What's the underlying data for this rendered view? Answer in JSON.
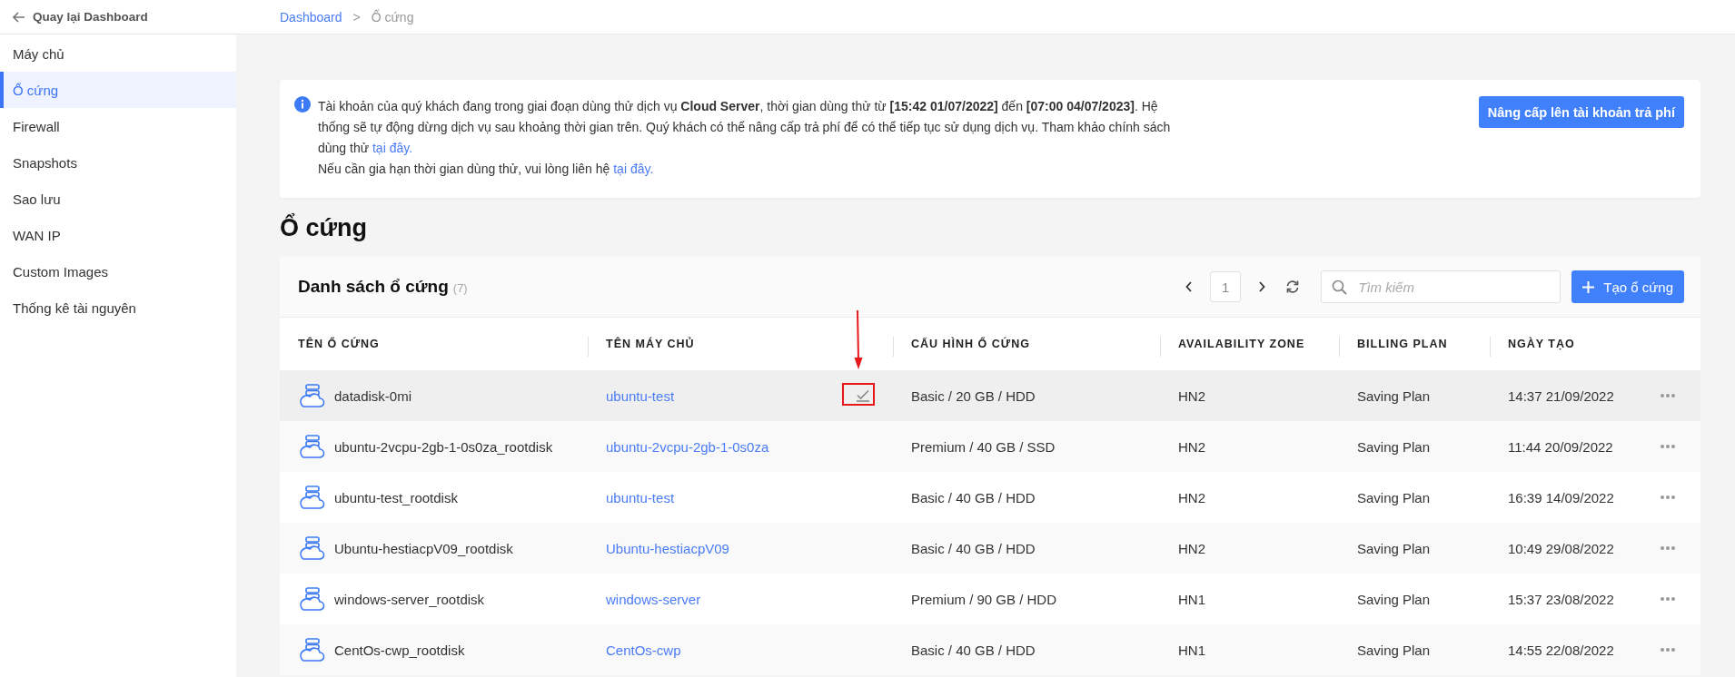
{
  "back_link": "Quay lại Dashboard",
  "breadcrumb": [
    {
      "label": "Dashboard",
      "kind": "link"
    },
    {
      "label": ">",
      "kind": "separator"
    },
    {
      "label": "Ổ cứng",
      "kind": "current"
    }
  ],
  "sidebar": {
    "items": [
      {
        "label": "Máy chủ",
        "selected": false
      },
      {
        "label": "Ổ cứng",
        "selected": true
      },
      {
        "label": "Firewall",
        "selected": false
      },
      {
        "label": "Snapshots",
        "selected": false
      },
      {
        "label": "Sao lưu",
        "selected": false
      },
      {
        "label": "WAN IP",
        "selected": false
      },
      {
        "label": "Custom Images",
        "selected": false
      },
      {
        "label": "Thống kê tài nguyên",
        "selected": false
      }
    ]
  },
  "notice": {
    "paragraphs": [
      {
        "text": "Tài khoản của quý khách đang trong giai đoạn dùng thử dịch vụ **Cloud Server**, thời gian dùng thử từ **[15:42 01/07/2022]** đến **[07:00 04/07/2023]**. Hệ thống sẽ tự động dừng dịch vụ sau khoảng thời gian trên. Quý khách có thể nâng cấp trả phí để có thể tiếp tục sử dụng dịch vụ. Tham khảo chính sách dùng thử",
        "link": "tại đây."
      },
      {
        "text": "Nếu cần gia hạn thời gian dùng thử, vui lòng liên hệ",
        "link": "tại đây."
      }
    ],
    "button": "Nâng cấp lên tài khoản trả phí"
  },
  "page_title": "Ổ cứng",
  "disk_list": {
    "title": "Danh sách ổ cứng",
    "count": "(7)",
    "pagination": {
      "page": "1"
    },
    "search": {
      "placeholder": "Tìm kiếm"
    },
    "create_button": "Tạo ổ cứng",
    "columns": [
      "TÊN Ổ CỨNG",
      "TÊN MÁY CHỦ",
      "CẤU HÌNH Ổ CỨNG",
      "AVAILABILITY ZONE",
      "BILLING PLAN",
      "NGÀY TẠO"
    ],
    "rows": [
      {
        "name": "datadisk-0mi",
        "server": "ubuntu-test",
        "config": "Basic / 20 GB / HDD",
        "zone": "HN2",
        "billing": "Saving Plan",
        "created": "14:37 21/09/2022",
        "hovered": true,
        "marked": true
      },
      {
        "name": "ubuntu-2vcpu-2gb-1-0s0za_rootdisk",
        "server": "ubuntu-2vcpu-2gb-1-0s0za",
        "config": "Premium / 40 GB / SSD",
        "zone": "HN2",
        "billing": "Saving Plan",
        "created": "11:44 20/09/2022",
        "hovered": false,
        "marked": false
      },
      {
        "name": "ubuntu-test_rootdisk",
        "server": "ubuntu-test",
        "config": "Basic / 40 GB / HDD",
        "zone": "HN2",
        "billing": "Saving Plan",
        "created": "16:39 14/09/2022",
        "hovered": false,
        "marked": false
      },
      {
        "name": "Ubuntu-hestiacpV09_rootdisk",
        "server": "Ubuntu-hestiacpV09",
        "config": "Basic / 40 GB / HDD",
        "zone": "HN2",
        "billing": "Saving Plan",
        "created": "10:49 29/08/2022",
        "hovered": false,
        "marked": false
      },
      {
        "name": "windows-server_rootdisk",
        "server": "windows-server",
        "config": "Premium / 90 GB / HDD",
        "zone": "HN1",
        "billing": "Saving Plan",
        "created": "15:37 23/08/2022",
        "hovered": false,
        "marked": false
      },
      {
        "name": "CentOs-cwp_rootdisk",
        "server": "CentOs-cwp",
        "config": "Basic / 40 GB / HDD",
        "zone": "HN1",
        "billing": "Saving Plan",
        "created": "14:55 22/08/2022",
        "hovered": false,
        "marked": false
      }
    ]
  }
}
